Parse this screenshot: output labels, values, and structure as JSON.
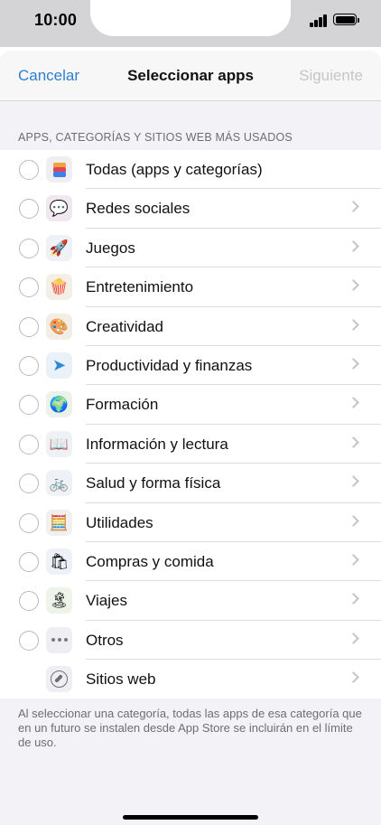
{
  "status_bar": {
    "time": "10:00"
  },
  "nav": {
    "cancel_label": "Cancelar",
    "title": "Seleccionar apps",
    "next_label": "Siguiente"
  },
  "section_header": "APPS, CATEGORÍAS Y SITIOS WEB MÁS USADOS",
  "categories": [
    {
      "label": "Todas (apps y categorías)",
      "icon": "layers-icon",
      "glyph": "",
      "has_radio": true,
      "has_chevron": false
    },
    {
      "label": "Redes sociales",
      "icon": "chat-heart-icon",
      "glyph": "💬",
      "has_radio": true,
      "has_chevron": true
    },
    {
      "label": "Juegos",
      "icon": "rocket-icon",
      "glyph": "🚀",
      "has_radio": true,
      "has_chevron": true
    },
    {
      "label": "Entretenimiento",
      "icon": "popcorn-icon",
      "glyph": "🍿",
      "has_radio": true,
      "has_chevron": true
    },
    {
      "label": "Creatividad",
      "icon": "palette-icon",
      "glyph": "🎨",
      "has_radio": true,
      "has_chevron": true
    },
    {
      "label": "Productividad y finanzas",
      "icon": "paper-plane-icon",
      "glyph": "➤",
      "has_radio": true,
      "has_chevron": true
    },
    {
      "label": "Formación",
      "icon": "globe-icon",
      "glyph": "🌍",
      "has_radio": true,
      "has_chevron": true
    },
    {
      "label": "Información y lectura",
      "icon": "book-icon",
      "glyph": "📖",
      "has_radio": true,
      "has_chevron": true
    },
    {
      "label": "Salud y forma física",
      "icon": "bicycle-icon",
      "glyph": "🚲",
      "has_radio": true,
      "has_chevron": true
    },
    {
      "label": "Utilidades",
      "icon": "calculator-icon",
      "glyph": "🧮",
      "has_radio": true,
      "has_chevron": true
    },
    {
      "label": "Compras y comida",
      "icon": "shopping-bag-icon",
      "glyph": "🛍",
      "has_radio": true,
      "has_chevron": true
    },
    {
      "label": "Viajes",
      "icon": "island-icon",
      "glyph": "🏝",
      "has_radio": true,
      "has_chevron": true
    },
    {
      "label": "Otros",
      "icon": "more-dots-icon",
      "glyph": "",
      "has_radio": true,
      "has_chevron": true
    },
    {
      "label": "Sitios web",
      "icon": "compass-icon",
      "glyph": "",
      "has_radio": false,
      "has_chevron": true
    }
  ],
  "footer_text": "Al seleccionar una categoría, todas las apps de esa categoría que en un futuro se instalen desde App Store se incluirán en el límite de uso.",
  "colors": {
    "accent": "#2f7fd0",
    "disabled": "#c5c5c9",
    "grouped_background": "#f2f2f7"
  }
}
